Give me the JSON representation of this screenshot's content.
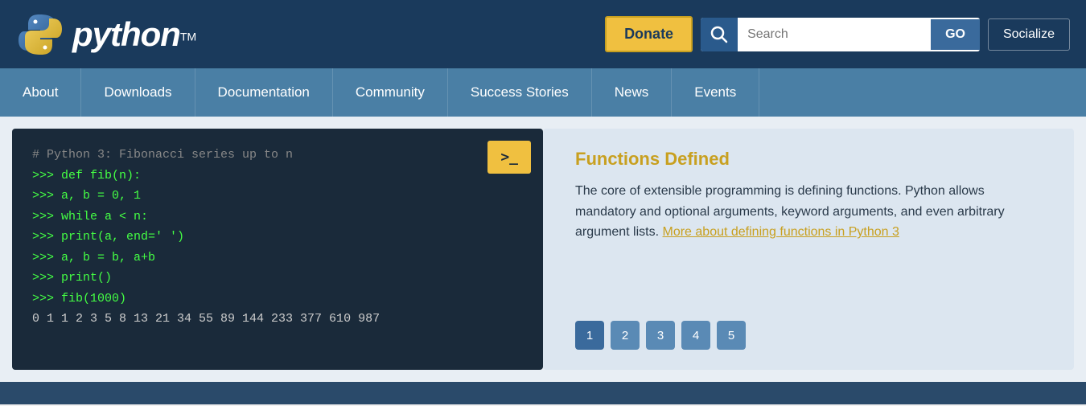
{
  "header": {
    "logo_text": "python",
    "tm": "TM",
    "donate_label": "Donate",
    "search_placeholder": "Search",
    "go_label": "GO",
    "socialize_label": "Socialize"
  },
  "nav": {
    "items": [
      {
        "label": "About",
        "id": "about"
      },
      {
        "label": "Downloads",
        "id": "downloads"
      },
      {
        "label": "Documentation",
        "id": "documentation"
      },
      {
        "label": "Community",
        "id": "community"
      },
      {
        "label": "Success Stories",
        "id": "success-stories"
      },
      {
        "label": "News",
        "id": "news"
      },
      {
        "label": "Events",
        "id": "events"
      }
    ]
  },
  "code": {
    "terminal_icon": ">_",
    "lines": [
      {
        "type": "comment",
        "text": "# Python 3: Fibonacci series up to n"
      },
      {
        "type": "prompt_green",
        "text": ">>> def fib(n):"
      },
      {
        "type": "prompt_green",
        "text": ">>>     a, b = 0, 1"
      },
      {
        "type": "prompt_green",
        "text": ">>>     while a < n:"
      },
      {
        "type": "prompt_green",
        "text": ">>>         print(a, end=' ')"
      },
      {
        "type": "prompt_green",
        "text": ">>>         a, b = b, a+b"
      },
      {
        "type": "prompt_green",
        "text": ">>>     print()"
      },
      {
        "type": "prompt_green",
        "text": ">>> fib(1000)"
      },
      {
        "type": "output",
        "text": "0 1 1 2 3 5 8 13 21 34 55 89 144 233 377 610 987"
      }
    ]
  },
  "info": {
    "title": "Functions Defined",
    "description": "The core of extensible programming is defining functions. Python allows mandatory and optional arguments, keyword arguments, and even arbitrary argument lists.",
    "link_text": "More about defining functions in Python 3",
    "link_href": "#"
  },
  "pagination": {
    "pages": [
      "1",
      "2",
      "3",
      "4",
      "5"
    ],
    "active": 0
  }
}
